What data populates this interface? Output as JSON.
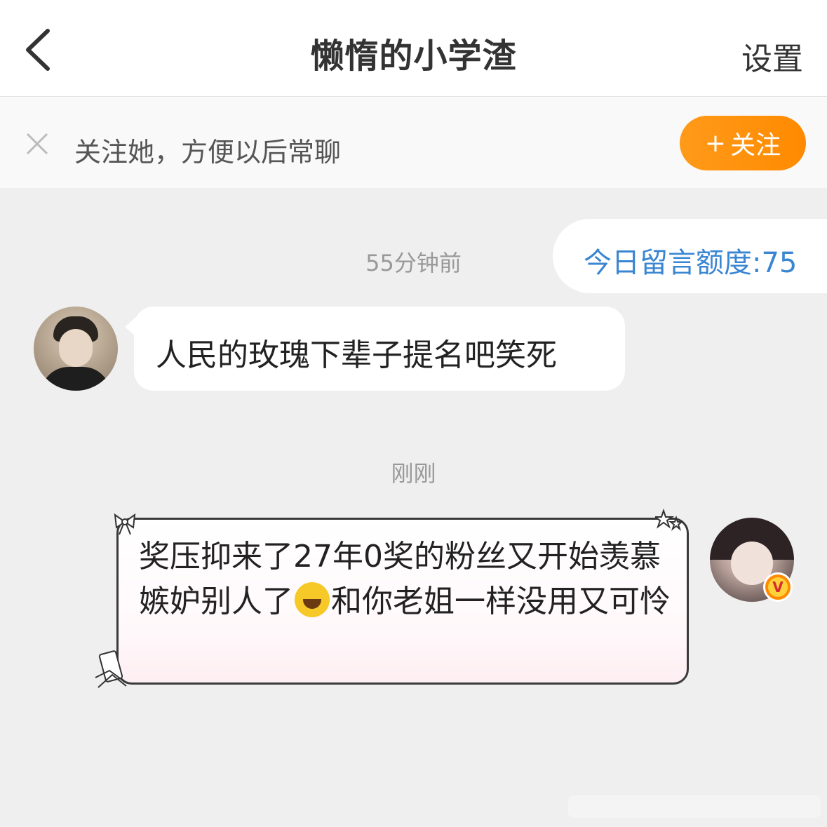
{
  "header": {
    "back_icon": "chevron-left-icon",
    "title": "懒惰的小学渣",
    "settings_label": "设置"
  },
  "follow_banner": {
    "close_icon": "close-icon",
    "text": "关注她，方便以后常聊",
    "button_plus": "+",
    "button_label": "关注",
    "accent_color": "#ff8a00"
  },
  "chat": {
    "quota_label": "今日留言额度:75",
    "messages": [
      {
        "timestamp": "55分钟前",
        "sender": "other",
        "text": "人民的玫瑰下辈子提名吧笑死"
      },
      {
        "timestamp": "刚刚",
        "sender": "self",
        "text_before_emoji": "奖压抑来了27年0奖的粉丝又开始羡慕嫉妒别人了",
        "emoji": "laughing-crying-emoji",
        "text_after_emoji": "和你老姐一样没用又可怜",
        "badge_icon": "v-badge-icon"
      }
    ]
  }
}
